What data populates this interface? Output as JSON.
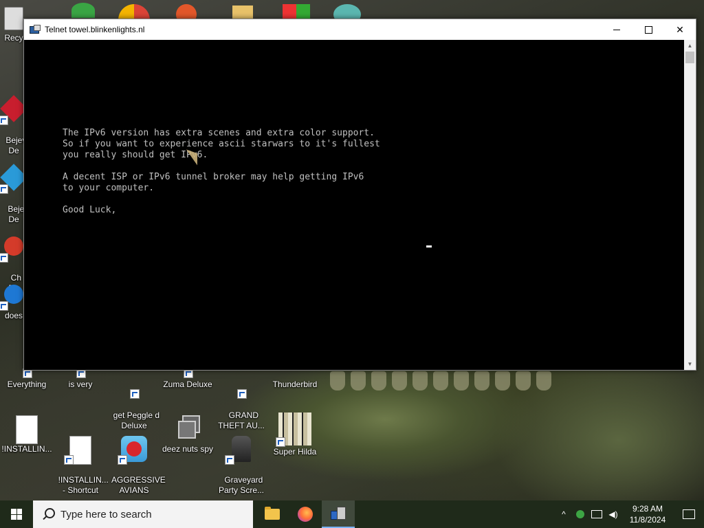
{
  "window": {
    "title": "Telnet towel.blinkenlights.nl",
    "console_text": "The IPv6 version has extra scenes and extra color support.\nSo if you want to experience ascii starwars to it's fullest\nyou really should get IPv6.\n\nA decent ISP or IPv6 tunnel broker may help getting IPv6\nto your computer.\n\nGood Luck,"
  },
  "desktop": {
    "left_icons": [
      {
        "label": "Recy"
      },
      {
        "label": "Bejev\nDe"
      },
      {
        "label": "Beje\nDe"
      },
      {
        "label": "Ch\nDe"
      },
      {
        "label": "does"
      }
    ],
    "row1": [
      {
        "label": "Everything"
      },
      {
        "label": "is very"
      },
      {
        "label": "get Peggle d\nDeluxe"
      },
      {
        "label": "Zuma Deluxe"
      },
      {
        "label": "GRAND\nTHEFT AU..."
      },
      {
        "label": "Thunderbird"
      }
    ],
    "row2": [
      {
        "label": "!INSTALLIN..."
      },
      {
        "label": "!INSTALLIN...\n- Shortcut"
      },
      {
        "label": "AGGRESSIVE\nAVIANS"
      },
      {
        "label": "deez nuts spy"
      },
      {
        "label": "Graveyard\nParty Scre..."
      },
      {
        "label": "Super Hilda"
      }
    ]
  },
  "taskbar": {
    "search_placeholder": "Type here to search",
    "apps": [
      {
        "name": "File Explorer",
        "icon": "folder-icon"
      },
      {
        "name": "Firefox",
        "icon": "firefox-icon"
      },
      {
        "name": "Telnet",
        "icon": "telnet-icon",
        "active": true
      }
    ],
    "time": "9:28 AM",
    "date": "11/8/2024"
  }
}
